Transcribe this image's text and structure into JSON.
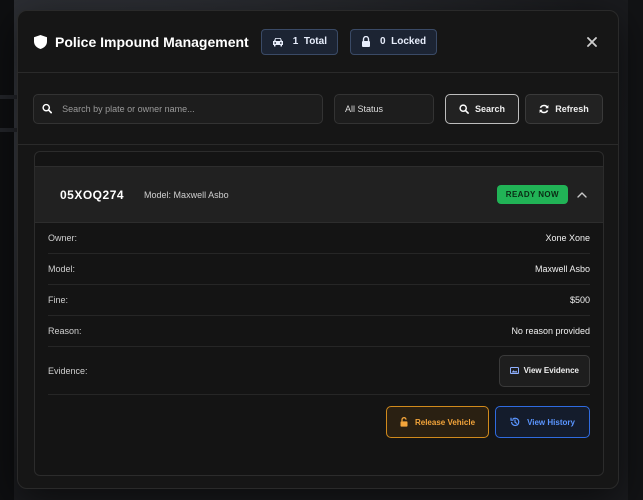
{
  "header": {
    "title": "Police Impound Management",
    "total_count": "1",
    "total_label": "Total",
    "locked_count": "0",
    "locked_label": "Locked"
  },
  "toolbar": {
    "search_placeholder": "Search by plate or owner name...",
    "status_value": "All Status",
    "search_label": "Search",
    "refresh_label": "Refresh"
  },
  "vehicle": {
    "plate": "05XOQ274",
    "model_header": "Model: Maxwell Asbo",
    "status_badge": "READY NOW",
    "fields": [
      {
        "label": "Owner:",
        "value": "Xone Xone"
      },
      {
        "label": "Model:",
        "value": "Maxwell Asbo"
      },
      {
        "label": "Fine:",
        "value": "$500"
      },
      {
        "label": "Reason:",
        "value": "No reason provided"
      }
    ],
    "evidence_label": "Evidence:",
    "view_evidence_label": "View Evidence",
    "release_label": "Release Vehicle",
    "history_label": "View History"
  },
  "colors": {
    "ready": "#21b356",
    "release": "#f3a43a",
    "history": "#5a95ff"
  }
}
